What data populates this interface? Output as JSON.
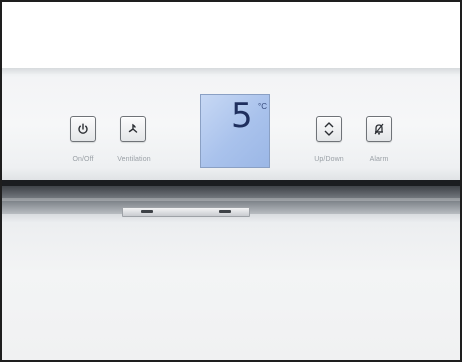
{
  "panel": {
    "buttons": [
      {
        "id": "onoff",
        "label": "On/Off",
        "icon": "power-icon"
      },
      {
        "id": "ventilation",
        "label": "Ventilation",
        "icon": "fan-icon"
      },
      {
        "id": "updown",
        "label": "Up/Down",
        "icon": "up-down-arrows-icon"
      },
      {
        "id": "alarm",
        "label": "Alarm",
        "icon": "bell-off-icon"
      }
    ],
    "display": {
      "temperature": "5",
      "unit": "°C"
    }
  },
  "colors": {
    "frame": "#1e1e1e",
    "lcd_background": "#a9c2ec",
    "lcd_digit": "#1f2f5e",
    "key_border": "#6f7378",
    "label_text": "#9aa0a6"
  }
}
